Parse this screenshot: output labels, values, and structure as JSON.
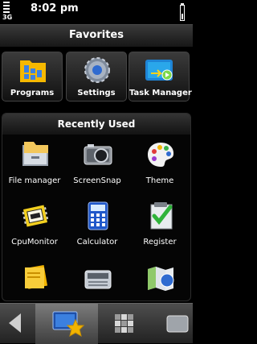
{
  "status": {
    "network": "3G",
    "time": "8:02 pm"
  },
  "favorites": {
    "title": "Favorites",
    "items": [
      {
        "label": "Programs",
        "icon": "programs-folder-icon"
      },
      {
        "label": "Settings",
        "icon": "gear-icon"
      },
      {
        "label": "Task Manager",
        "icon": "task-manager-icon"
      }
    ]
  },
  "recent": {
    "title": "Recently Used",
    "items": [
      {
        "label": "File manager",
        "icon": "folder-drawer-icon"
      },
      {
        "label": "ScreenSnap",
        "icon": "camera-icon"
      },
      {
        "label": "Theme",
        "icon": "palette-icon"
      },
      {
        "label": "CpuMonitor",
        "icon": "cpu-monitor-icon"
      },
      {
        "label": "Calculator",
        "icon": "calculator-icon"
      },
      {
        "label": "Register",
        "icon": "register-check-icon"
      },
      {
        "label": "",
        "icon": "notes-icon"
      },
      {
        "label": "",
        "icon": "radio-icon"
      },
      {
        "label": "",
        "icon": "map-icon"
      }
    ]
  },
  "bottom_bar": {
    "buttons": [
      "back-arrow-icon",
      "favorites-star-icon",
      "apps-grid-icon",
      "menu-icon"
    ]
  },
  "colors": {
    "background": "#000000",
    "text": "#ffffff",
    "accent_blue": "#1e6fd6",
    "accent_yellow": "#f2b400"
  }
}
